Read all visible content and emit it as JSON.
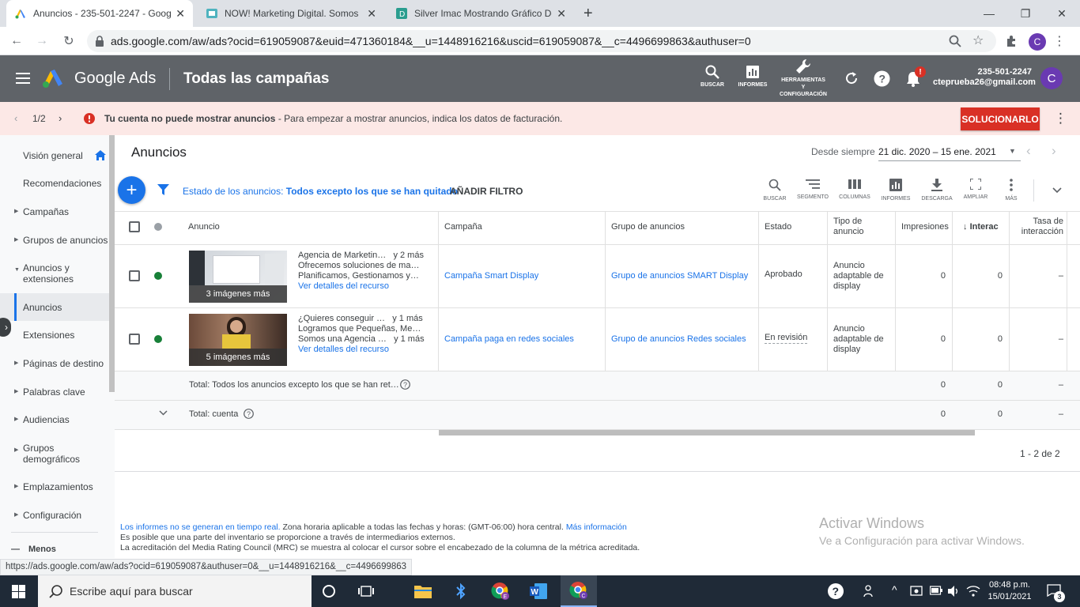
{
  "browser": {
    "tabs": [
      {
        "title": "Anuncios - 235-501-2247 - Goog"
      },
      {
        "title": "NOW! Marketing Digital. Somos"
      },
      {
        "title": "Silver Imac Mostrando Gráfico De"
      }
    ],
    "url": "ads.google.com/aw/ads?ocid=619059087&euid=471360184&__u=1448916216&uscid=619059087&__c=4496699863&authuser=0",
    "profile_initial": "C",
    "status_url": "https://ads.google.com/aw/ads?ocid=619059087&authuser=0&__u=1448916216&__c=4496699863"
  },
  "header": {
    "logo_text": "Google Ads",
    "page_title": "Todas las campañas",
    "icons": {
      "search": "BUSCAR",
      "reports": "INFORMES",
      "tools_1": "HERRAMIENTAS",
      "tools_2": "Y",
      "tools_3": "CONFIGURACIÓN"
    },
    "notif_badge": "!",
    "account_id": "235-501-2247",
    "account_email": "cteprueba26@gmail.com",
    "avatar": "C"
  },
  "notice": {
    "pager": "1/2",
    "bold": "Tu cuenta no puede mostrar anuncios",
    "text": " - Para empezar a mostrar anuncios, indica los datos de facturación.",
    "fix_label": "SOLUCIONARLO"
  },
  "sidebar": {
    "items": [
      {
        "label": "Visión general"
      },
      {
        "label": "Recomendaciones"
      },
      {
        "label": "Campañas"
      },
      {
        "label": "Grupos de anuncios"
      },
      {
        "label": "Anuncios y"
      },
      {
        "label": "Anuncios"
      },
      {
        "label": "Extensiones"
      },
      {
        "label": "Páginas de destino"
      },
      {
        "label": "Palabras clave"
      },
      {
        "label": "Audiencias"
      },
      {
        "label": "Grupos"
      },
      {
        "label": "Emplazamientos"
      },
      {
        "label": "Configuración"
      }
    ],
    "item4_line2": "extensiones",
    "item10_line2": "demográficos",
    "less": "Menos"
  },
  "main": {
    "title": "Anuncios",
    "date_label": "Desde siempre",
    "date_range": "21 dic. 2020 – 15 ene. 2021",
    "filter_label": "Estado de los anuncios: ",
    "filter_value": "Todos excepto los que se han quitado",
    "add_filter": "AÑADIR FILTRO",
    "toolbar": {
      "search": "BUSCAR",
      "segment": "SEGMENTO",
      "columns": "COLUMNAS",
      "reports": "INFORMES",
      "download": "DESCARGA",
      "expand": "AMPLIAR",
      "more": "MÁS"
    },
    "columns": {
      "ad": "Anuncio",
      "campaign": "Campaña",
      "adgroup": "Grupo de anuncios",
      "status": "Estado",
      "type1": "Tipo de",
      "type2": "anuncio",
      "impr": "Impresiones",
      "inter": "Interac",
      "rate1": "Tasa de",
      "rate2": "interacción"
    },
    "rows": [
      {
        "line1": "Agencia de Marketin…",
        "line1b": "y 2 más",
        "line2": "Ofrecemos soluciones de ma…",
        "line3": "Planificamos, Gestionamos y…",
        "details": "Ver detalles del recurso",
        "images": "3 imágenes más",
        "campaign": "Campaña Smart Display",
        "adgroup": "Grupo de anuncios SMART Display",
        "status": "Aprobado",
        "type1": "Anuncio",
        "type2": "adaptable de",
        "type3": "display",
        "impr": "0",
        "inter": "0",
        "rate": "–"
      },
      {
        "line1": "¿Quieres conseguir …",
        "line1b": "y 1 más",
        "line2": "Logramos que Pequeñas, Me…",
        "line3": "Somos una Agencia …",
        "line3b": "y 1 más",
        "details": "Ver detalles del recurso",
        "images": "5 imágenes más",
        "campaign": "Campaña paga en redes sociales",
        "adgroup": "Grupo de anuncios Redes sociales",
        "status": "En revisión",
        "type1": "Anuncio",
        "type2": "adaptable de",
        "type3": "display",
        "impr": "0",
        "inter": "0",
        "rate": "–"
      }
    ],
    "total1": {
      "label": "Total: Todos los anuncios excepto los que se han ret…",
      "impr": "0",
      "inter": "0",
      "rate": "–"
    },
    "total2": {
      "label": "Total: cuenta",
      "impr": "0",
      "inter": "0",
      "rate": "–"
    },
    "pagination": "1 - 2 de 2"
  },
  "footer": {
    "l1_link": "Los informes no se generan en tiempo real.",
    "l1_text": " Zona horaria aplicable a todas las fechas y horas: (GMT-06:00) hora central. ",
    "l1_link2": "Más información",
    "l2": "Es posible que una parte del inventario se proporcione a través de intermediarios externos.",
    "l3": "La acreditación del Media Rating Council (MRC) se muestra al colocar el cursor sobre el encabezado de la columna de la métrica acreditada."
  },
  "activate": {
    "title": "Activar Windows",
    "sub": "Ve a Configuración para activar Windows."
  },
  "taskbar": {
    "search_placeholder": "Escribe aquí para buscar",
    "time": "08:48 p.m.",
    "date": "15/01/2021",
    "notif_count": "3"
  },
  "colors": {
    "accent": "#1a73e8",
    "header": "#5f6368",
    "danger": "#d93025",
    "notice_bg": "#fce8e6"
  }
}
